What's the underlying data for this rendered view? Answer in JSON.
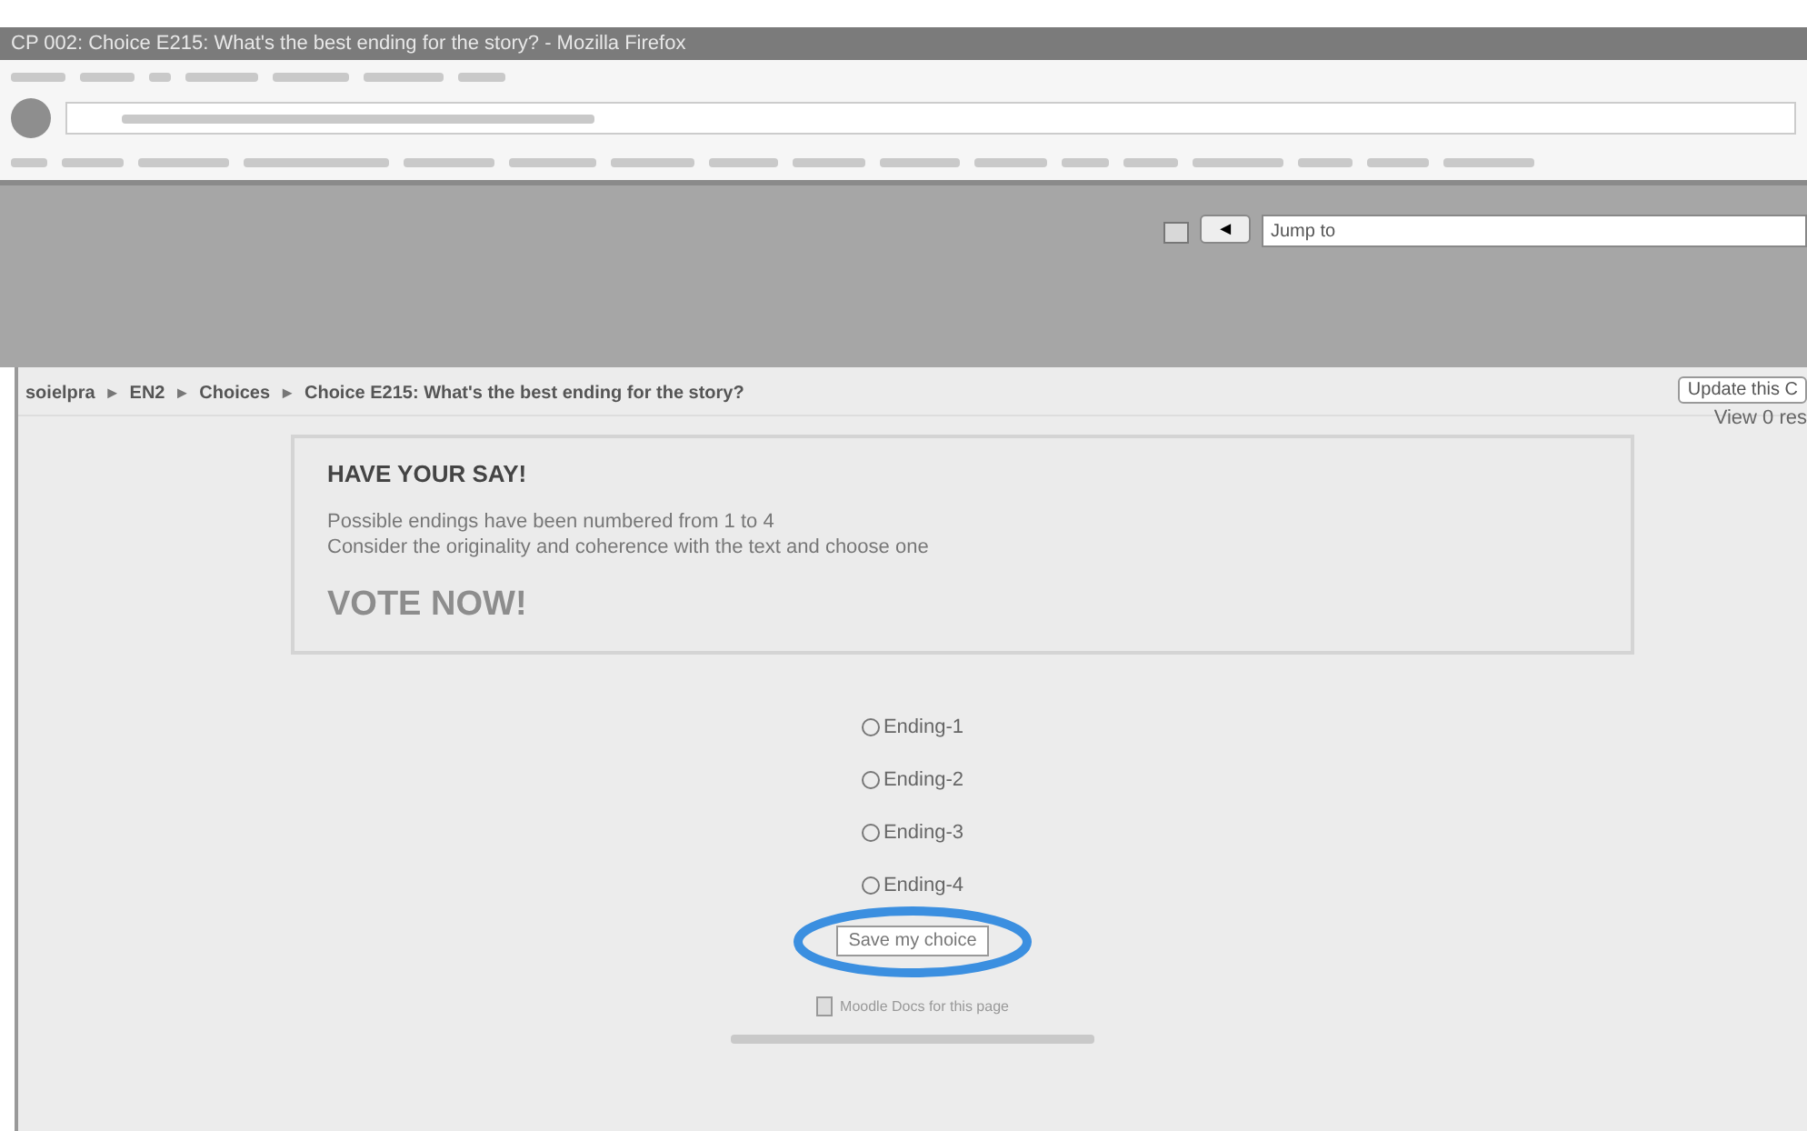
{
  "window": {
    "title": "CP 002: Choice E215: What's the best ending for the story? - Mozilla Firefox"
  },
  "header": {
    "jump_to": {
      "placeholder": "Jump to"
    },
    "jump_button": "◄"
  },
  "breadcrumb_separator": "►",
  "breadcrumb": [
    {
      "label": "soielpra"
    },
    {
      "label": "EN2"
    },
    {
      "label": "Choices"
    },
    {
      "label": "Choice E215: What's the best ending for the story?"
    }
  ],
  "side_actions": {
    "button": "Update this C",
    "link": "View 0 res"
  },
  "intro": {
    "heading": "HAVE YOUR SAY!",
    "lines": [
      "Possible endings have been numbered from 1 to 4",
      "Consider the originality and coherence with the text and choose one"
    ],
    "call": "VOTE NOW!"
  },
  "options": [
    {
      "label": "Ending-1",
      "selected": false
    },
    {
      "label": "Ending-2",
      "selected": false
    },
    {
      "label": "Ending-3",
      "selected": false
    },
    {
      "label": "Ending-4",
      "selected": false
    }
  ],
  "submit": "Save my choice",
  "highlight": {
    "color": "#3b8fe0"
  },
  "footer": {
    "docs": "Moodle Docs for this page"
  }
}
